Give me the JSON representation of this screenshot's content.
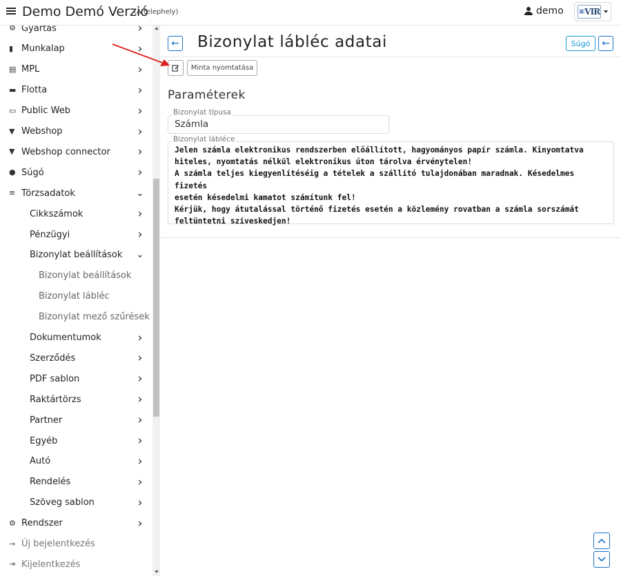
{
  "header": {
    "app_title": "Demo Demó Verzió",
    "site": "(A telephely)",
    "user": "demo",
    "logo_text": "VIR"
  },
  "sidebar": {
    "items": [
      {
        "label": "Gyártás",
        "icon": "gears-icon",
        "level": 1,
        "chevron": "right"
      },
      {
        "label": "Munkalap",
        "icon": "file-icon",
        "level": 1,
        "chevron": "right"
      },
      {
        "label": "MPL",
        "icon": "pallet-icon",
        "level": 1,
        "chevron": "right"
      },
      {
        "label": "Flotta",
        "icon": "car-icon",
        "level": 1,
        "chevron": "right"
      },
      {
        "label": "Public Web",
        "icon": "laptop-icon",
        "level": 1,
        "chevron": "right"
      },
      {
        "label": "Webshop",
        "icon": "cart-icon",
        "level": 1,
        "chevron": "right"
      },
      {
        "label": "Webshop connector",
        "icon": "cart-icon",
        "level": 1,
        "chevron": "right"
      },
      {
        "label": "Súgó",
        "icon": "help-circle-icon",
        "level": 1,
        "chevron": "right"
      },
      {
        "label": "Törzsadatok",
        "icon": "database-icon",
        "level": 1,
        "chevron": "down"
      },
      {
        "label": "Cikkszámok",
        "level": 2,
        "chevron": "right"
      },
      {
        "label": "Pénzügyi",
        "level": 2,
        "chevron": "right"
      },
      {
        "label": "Bizonylat beállítások",
        "level": 2,
        "chevron": "down"
      },
      {
        "label": "Bizonylat beállítások",
        "level": 3,
        "chevron": ""
      },
      {
        "label": "Bizonylat lábléc",
        "level": 3,
        "chevron": ""
      },
      {
        "label": "Bizonylat mező szűrések",
        "level": 3,
        "chevron": ""
      },
      {
        "label": "Dokumentumok",
        "level": 2,
        "chevron": "right"
      },
      {
        "label": "Szerződés",
        "level": 2,
        "chevron": "right"
      },
      {
        "label": "PDF sablon",
        "level": 2,
        "chevron": "right"
      },
      {
        "label": "Raktártörzs",
        "level": 2,
        "chevron": "right"
      },
      {
        "label": "Partner",
        "level": 2,
        "chevron": "right"
      },
      {
        "label": "Egyéb",
        "level": 2,
        "chevron": "right"
      },
      {
        "label": "Autó",
        "level": 2,
        "chevron": "right"
      },
      {
        "label": "Rendelés",
        "level": 2,
        "chevron": "right"
      },
      {
        "label": "Szöveg sablon",
        "level": 2,
        "chevron": "right"
      },
      {
        "label": "Rendszer",
        "icon": "cogs-icon",
        "level": 1,
        "chevron": "right"
      },
      {
        "label": "Új bejelentkezés",
        "icon": "sign-in-icon",
        "level": 1,
        "chevron": "",
        "muted": true
      },
      {
        "label": "Kijelentkezés",
        "icon": "sign-out-icon",
        "level": 1,
        "chevron": "",
        "muted": true
      }
    ]
  },
  "main": {
    "title": "Bizonylat lábléc adatai",
    "help_label": "Súgó",
    "print_sample_label": "Minta nyomtatása",
    "section_title": "Paraméterek",
    "type_label": "Bizonylat típusa",
    "type_value": "Számla",
    "footer_label": "Bizonylat lábléce",
    "footer_text": "Jelen számla elektronikus rendszerben előállított, hagyományos papír számla.  Kinyomtatva\nhiteles, nyomtatás nélkül elektronikus úton tárolva érvénytelen!\nA számla teljes kiegyenlítéséig a tételek a szállító tulajdonában maradnak. Késedelmes fizetés\nesetén késedelmi kamatot számítunk fel!\nKérjük, hogy átutalással történő fizetés esetén a közlemény rovatban a számla sorszámát\nfeltüntetni szíveskedjen!"
  },
  "colors": {
    "accent_blue": "#1a73c8",
    "help_blue": "#1a9bd8",
    "annotation_red": "#e02020"
  }
}
